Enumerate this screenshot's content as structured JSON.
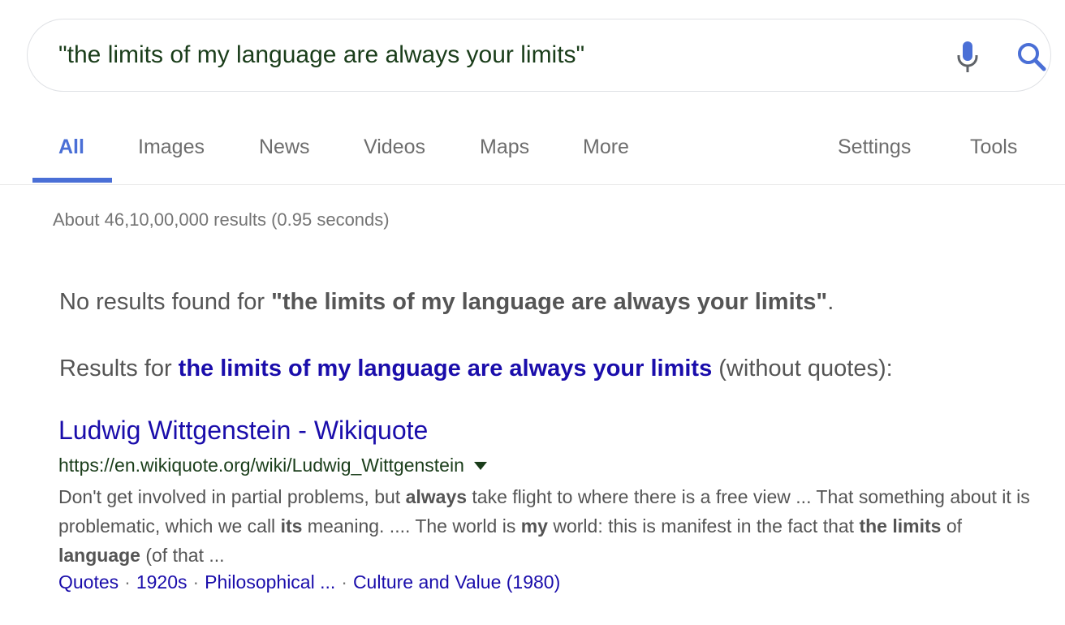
{
  "search": {
    "query": "\"the limits of my language are always your limits\""
  },
  "tabs": [
    {
      "label": "All",
      "active": true
    },
    {
      "label": "Images"
    },
    {
      "label": "News"
    },
    {
      "label": "Videos"
    },
    {
      "label": "Maps"
    },
    {
      "label": "More"
    },
    {
      "label": "Settings"
    },
    {
      "label": "Tools"
    }
  ],
  "stats": "About 46,10,00,000 results (0.95 seconds)",
  "spelling": {
    "no_results_prefix": "No results found for ",
    "no_results_query": "\"the limits of my language are always your limits\"",
    "no_results_suffix": ".",
    "results_for_prefix": "Results for ",
    "results_for_link": "the limits of my language are always your limits",
    "results_for_suffix": " (without quotes):"
  },
  "result": {
    "title": "Ludwig Wittgenstein - Wikiquote",
    "url": "https://en.wikiquote.org/wiki/Ludwig_Wittgenstein",
    "snippet_parts": [
      "Don't get involved in partial problems, but ",
      "always",
      " take flight to where there is a free view ... That something about it is problematic, which we call ",
      "its",
      " meaning. .... The world is ",
      "my",
      " world: this is manifest in the fact that ",
      "the limits",
      " of ",
      "language",
      " (of that ..."
    ],
    "sitelinks": [
      "Quotes",
      "1920s",
      "Philosophical ...",
      "Culture and Value (1980)"
    ],
    "sitelink_separator": "·"
  },
  "colors": {
    "accent_blue": "#4a6fd6",
    "link_blue": "#1a0dab",
    "url_green": "#1a3d1a",
    "mic_blue": "#4a6fd6"
  },
  "icons": {
    "mic": "microphone-icon",
    "search": "search-icon",
    "caret": "caret-down-icon"
  }
}
